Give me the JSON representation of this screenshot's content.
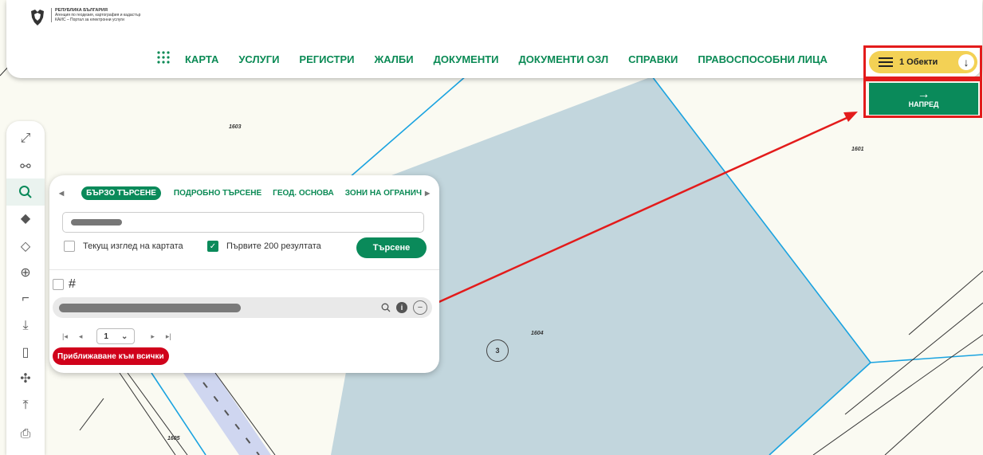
{
  "header": {
    "logo_line1": "РЕПУБЛИКА БЪЛГАРИЯ",
    "logo_line2": "Агенция по геодезия, картография и кадастър",
    "logo_line3": "КАИС – Портал за електронни услуги"
  },
  "nav": {
    "items": [
      "КАРТА",
      "УСЛУГИ",
      "РЕГИСТРИ",
      "ЖАЛБИ",
      "ДОКУМЕНТИ",
      "ДОКУМЕНТИ ОЗЛ",
      "СПРАВКИ",
      "ПРАВОСПОСОБНИ ЛИЦА"
    ]
  },
  "cart": {
    "label": "1 Обекти"
  },
  "next_button": {
    "label": "НАПРЕД"
  },
  "search_panel": {
    "tabs": [
      "БЪРЗО ТЪРСЕНЕ",
      "ПОДРОБНО ТЪРСЕНЕ",
      "ГЕОД. ОСНОВА",
      "ЗОНИ НА ОГРАНИЧ"
    ],
    "current_view_label": "Текущ изглед на картата",
    "current_view_checked": false,
    "first200_label": "Първите 200 резултата",
    "first200_checked": true,
    "search_button": "Търсене",
    "page": "1",
    "zoom_all_button": "Приближаване към всички"
  },
  "map": {
    "labels": [
      "1603",
      "1601",
      "1604",
      "1605"
    ],
    "parcel_number": "3"
  },
  "colors": {
    "accent": "#0a8a5a",
    "cart": "#f3d155",
    "highlight": "#e31b1b",
    "zoom_all": "#d0021b",
    "parcel_fill": "#c2d6dd"
  },
  "toolbar": {
    "icons": [
      "fullscreen-icon",
      "network-icon",
      "search-icon",
      "layers-filled-icon",
      "layers-outline-icon",
      "globe-icon",
      "measure-icon",
      "download-icon",
      "map-icon",
      "coordinates-icon",
      "upload-icon",
      "print-icon"
    ]
  }
}
